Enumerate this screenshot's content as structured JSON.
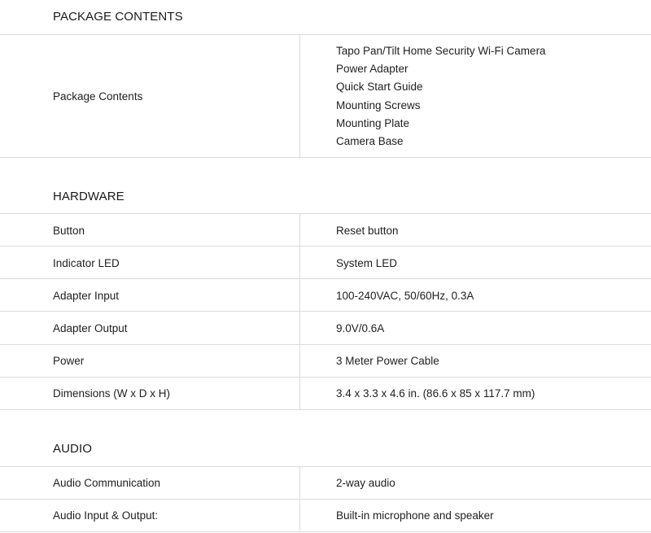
{
  "sections": {
    "package_contents": {
      "title": "PACKAGE CONTENTS",
      "row_label": "Package Contents",
      "items": [
        "Tapo Pan/Tilt Home Security Wi-Fi Camera",
        "Power Adapter",
        "Quick Start Guide",
        "Mounting Screws",
        "Mounting Plate",
        "Camera Base"
      ]
    },
    "hardware": {
      "title": "HARDWARE",
      "rows": [
        {
          "label": "Button",
          "value": "Reset button"
        },
        {
          "label": "Indicator LED",
          "value": "System LED"
        },
        {
          "label": "Adapter Input",
          "value": "100-240VAC, 50/60Hz, 0.3A"
        },
        {
          "label": "Adapter Output",
          "value": "9.0V/0.6A"
        },
        {
          "label": "Power",
          "value": "3 Meter Power Cable"
        },
        {
          "label": "Dimensions (W x D x H)",
          "value": "3.4 x 3.3 x 4.6 in. (86.6 x 85 x 117.7 mm)"
        }
      ]
    },
    "audio": {
      "title": "AUDIO",
      "rows": [
        {
          "label": "Audio Communication",
          "value": "2-way audio"
        },
        {
          "label": "Audio Input & Output:",
          "value": "Built-in microphone and speaker"
        }
      ]
    }
  }
}
